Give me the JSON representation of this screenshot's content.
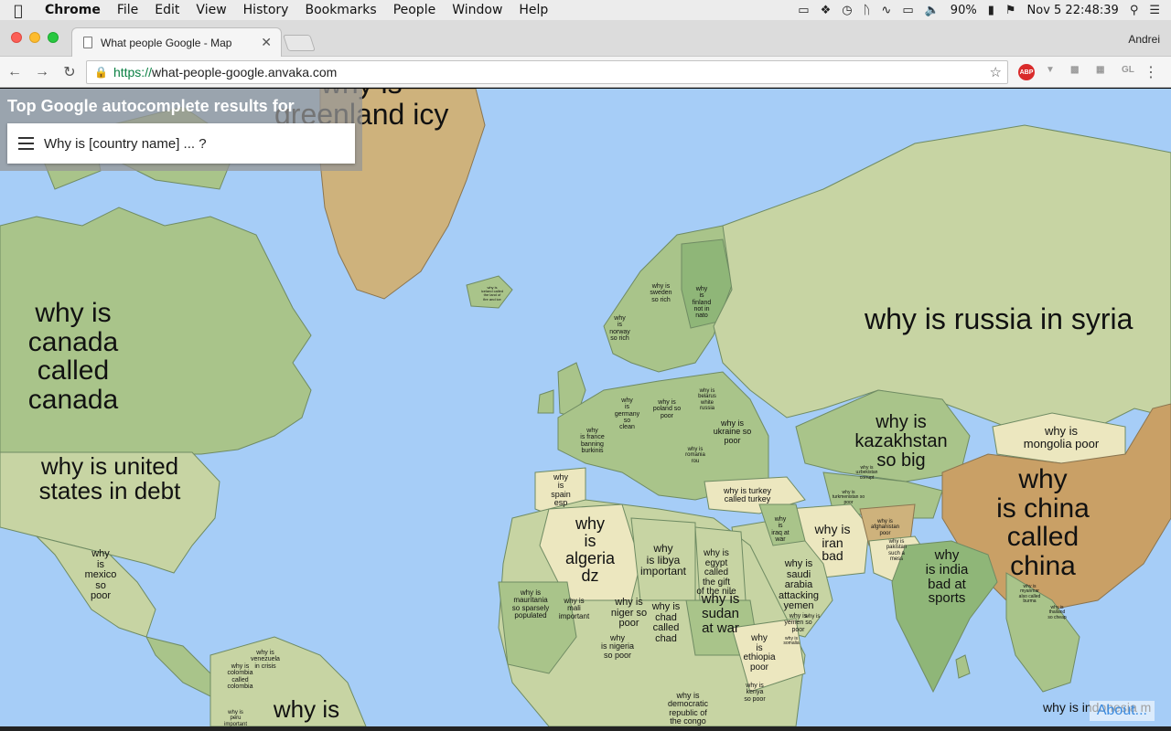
{
  "menubar": {
    "app": "Chrome",
    "items": [
      "File",
      "Edit",
      "View",
      "History",
      "Bookmarks",
      "People",
      "Window",
      "Help"
    ],
    "battery": "90%",
    "clock": "Nov 5  22:48:39"
  },
  "tab": {
    "title": "What people Google - Map",
    "profile": "Andrei"
  },
  "address": {
    "scheme": "https://",
    "host": "what-people-google.anvaka.com"
  },
  "extensions": {
    "abp": "ABP",
    "gl": "GL"
  },
  "panel": {
    "heading": "Top Google autocomplete results for",
    "query": "Why is [country name] ... ?"
  },
  "about": "About...",
  "labels": {
    "greenland": "why is\ngreenland icy",
    "canada": "why is\ncanada\ncalled\ncanada",
    "usa": "why is united\nstates in debt",
    "mexico": "why\nis\nmexico\nso\npoor",
    "russia": "why is russia in syria",
    "kazakhstan": "why is\nkazakhstan\nso big",
    "mongolia": "why is\nmongolia poor",
    "china": "why\nis china\ncalled\nchina",
    "india": "why\nis india\nbad at\nsports",
    "iran": "why is\niran\nbad",
    "saudi": "why is\nsaudi\narabia\nattacking\nyemen",
    "algeria": "why\nis\nalgeria\ndz",
    "libya": "why\nis libya\nimportant",
    "egypt": "why is\negypt\ncalled\nthe gift\nof the nile",
    "sudan": "why is\nsudan\nat war",
    "chad": "why is\nchad\ncalled\nchad",
    "niger": "why is\nniger so\npoor",
    "mali": "why is\nmali\nimportant",
    "mauritania": "why is\nmauritania\nso sparsely\npopulated",
    "nigeria": "why\nis nigeria\nso poor",
    "ethiopia": "why\nis\nethiopia\npoor",
    "congo": "why is\ndemocratic\nrepublic of\nthe congo",
    "kenya": "why is\nkenya\nso poor",
    "turkey": "why is turkey\ncalled turkey",
    "iraq": "why\nis\niraq at\nwar",
    "afghanistan": "why is\nafghanistan\npoor",
    "pakistan": "why is\npakistan\nsuch a\nmess",
    "spain": "why\nis\nspain\nesp",
    "france": "why\nis france\nbanning\nburkinis",
    "germany": "why\nis\ngermany\nso\nclean",
    "poland": "why is\npoland so\npoor",
    "ukraine": "why is\nukraine so\npoor",
    "belarus": "why is\nbelarus\nwhite\nrussia",
    "sweden": "why is\nsweden\nso rich",
    "norway": "why\nis\nnorway\nso rich",
    "finland": "why\nis\nfinland\nnot in\nnato",
    "iceland": "why is\niceland called\nthe land of\nfire and ice",
    "venezuela": "why is\nvenezuela\nin crisis",
    "colombia": "why is\ncolombia\ncalled\ncolombia",
    "peru": "why is\nperu\nimportant",
    "brazil": "why is",
    "indonesia": "why is indonesia m",
    "myanmar": "why is\nmyanmar\nalso called\nburma",
    "thailand": "why is\nthailand\nso cheap",
    "yemen": "why is\nyemen so\npoor",
    "oman": "why is",
    "uzbek": "why is\nuzbekistan\ncorrupt",
    "turkmen": "why is\nturkmenistan so\npoor",
    "romania": "why is\nromania\nrou",
    "somalia": "why is\nsomalia"
  },
  "colors": {
    "ocean": "#a6cdf7",
    "land_light": "#c7d4a3",
    "land_mid": "#a9c48a",
    "land_dark": "#8fb678",
    "tan": "#ceb27c",
    "orange": "#c9a066",
    "cream": "#ece7bf"
  }
}
